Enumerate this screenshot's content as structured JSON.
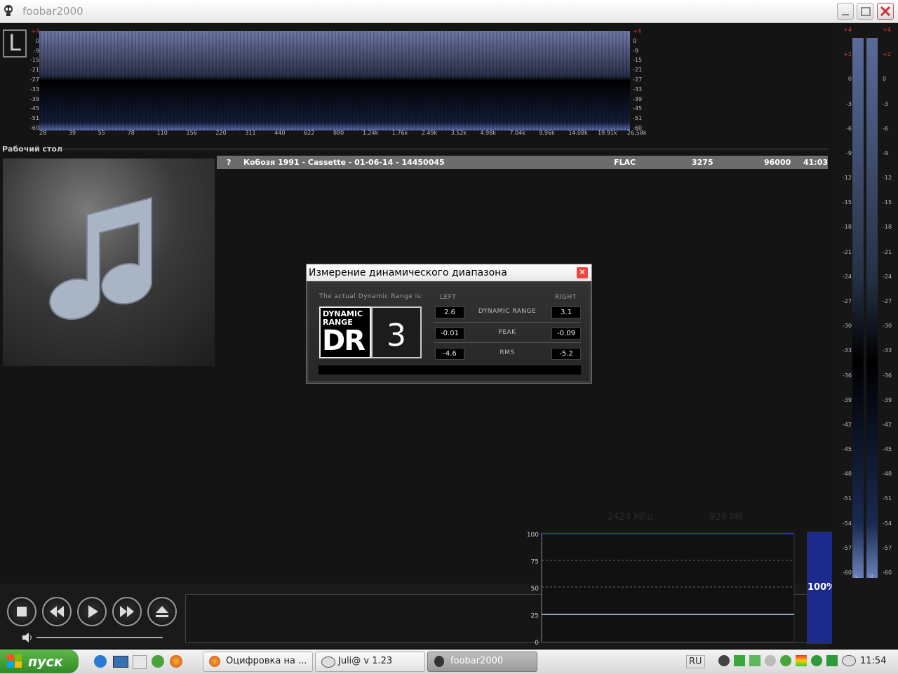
{
  "window": {
    "title": "foobar2000"
  },
  "spectrum": {
    "db_left": [
      "+4",
      "0",
      "-9",
      "-15",
      "-21",
      "-27",
      "-33",
      "-39",
      "-45",
      "-51",
      "-60"
    ],
    "db_right": [
      "+4",
      "0",
      "-9",
      "-15",
      "-21",
      "-27",
      "-33",
      "-39",
      "-45",
      "-51",
      "-60"
    ],
    "freq_labels": [
      "28",
      "39",
      "55",
      "78",
      "110",
      "156",
      "220",
      "311",
      "440",
      "622",
      "880",
      "1.24k",
      "1.76k",
      "2.49k",
      "3.52k",
      "4.98k",
      "7.04k",
      "9.96k",
      "14.08k",
      "19.91k",
      "26.58k"
    ],
    "channel_badge": "L"
  },
  "section": {
    "header": "Рабочий стол"
  },
  "playlist": {
    "rows": [
      {
        "status": "?",
        "title": "Кобозя 1991 - Cassette - 01-06-14 - 14450045",
        "codec": "FLAC",
        "bitrate": "3275",
        "samplerate": "96000",
        "duration": "41:03"
      }
    ]
  },
  "dialog": {
    "title": "Измерение динамического диапазона",
    "intro": "The actual Dynamic Range is:",
    "col_left": "LEFT",
    "col_right": "RIGHT",
    "logo_line1": "DYNAMIC",
    "logo_line2": "RANGE",
    "logo_big": "DR",
    "dr_value": "3",
    "rows": [
      {
        "label": "DYNAMIC RANGE",
        "left": "2.6",
        "right": "3.1"
      },
      {
        "label": "PEAK",
        "left": "-0.01",
        "right": "-0.09"
      },
      {
        "label": "RMS",
        "left": "-4.6",
        "right": "-5.2"
      }
    ]
  },
  "monitor": {
    "cpu": "2424 МГц",
    "mem": "929 Мб",
    "y_labels": [
      "100",
      "75",
      "50",
      "25",
      "0"
    ],
    "usage_percent": "100%",
    "usage_fraction": 1.0
  },
  "vu_meter": {
    "left_scale": [
      "+4",
      "+2",
      "0",
      "-3",
      "-6",
      "-9",
      "-12",
      "-15",
      "-18",
      "-21",
      "-24",
      "-27",
      "-30",
      "-33",
      "-36",
      "-39",
      "-42",
      "-45",
      "-48",
      "-51",
      "-54",
      "-57",
      "-60"
    ],
    "right_scale": [
      "+4",
      "+2",
      "0",
      "-3",
      "-6",
      "-9",
      "-12",
      "-15",
      "-18",
      "-21",
      "-24",
      "-27",
      "-30",
      "-33",
      "-36",
      "-39",
      "-42",
      "-45",
      "-48",
      "-51",
      "-54",
      "-57",
      "-60"
    ],
    "ch_left": "L",
    "ch_right": "R"
  },
  "taskbar": {
    "start_label": "пуск",
    "tasks": [
      {
        "label": "Оцифровка на ...",
        "icon": "firefox-icon"
      },
      {
        "label": "Juli@ v 1.23",
        "icon": "esi-icon"
      },
      {
        "label": "foobar2000",
        "icon": "foobar-icon"
      }
    ],
    "lang": "RU",
    "clock": "11:54"
  },
  "colors": {
    "background": "#141414",
    "accent_blue": "#1c2a8c",
    "playlist_row": "#6c6c6c",
    "start_green": "#3a9a2e"
  }
}
